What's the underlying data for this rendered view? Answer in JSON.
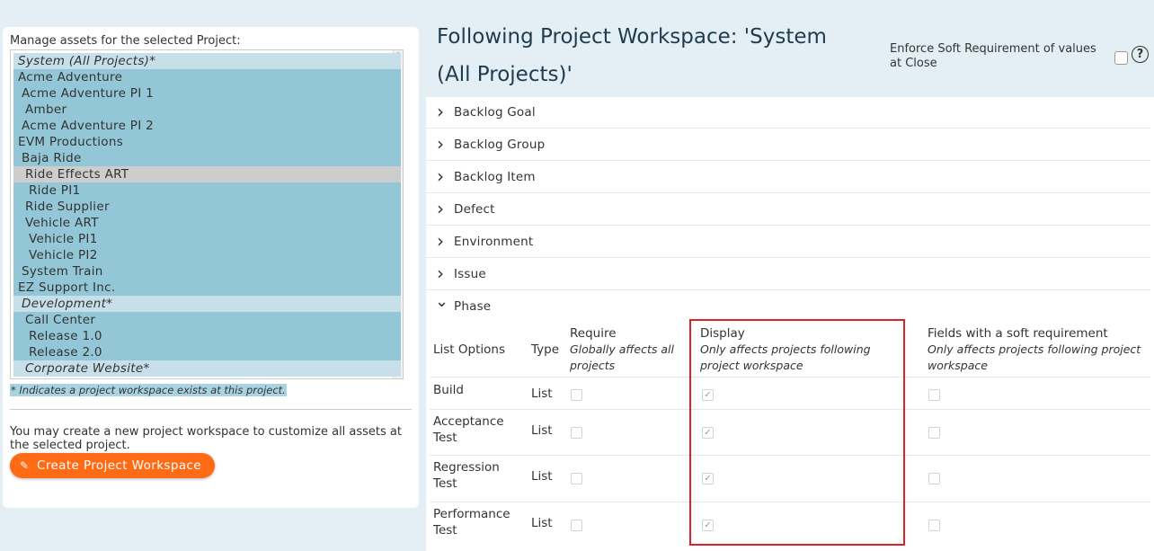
{
  "left_panel": {
    "manage_label": "Manage assets for the selected Project:",
    "projects": [
      {
        "label": "System (All Projects)*",
        "indent": 0,
        "workspace": true
      },
      {
        "label": "Acme Adventure",
        "indent": 0
      },
      {
        "label": "Acme Adventure PI 1",
        "indent": 1
      },
      {
        "label": "Amber",
        "indent": 2
      },
      {
        "label": "Acme Adventure PI 2",
        "indent": 1
      },
      {
        "label": "EVM Productions",
        "indent": 0
      },
      {
        "label": "Baja Ride",
        "indent": 1
      },
      {
        "label": "Ride Effects ART",
        "indent": 2,
        "selected": true
      },
      {
        "label": "Ride PI1",
        "indent": 3
      },
      {
        "label": "Ride Supplier",
        "indent": 2
      },
      {
        "label": "Vehicle ART",
        "indent": 2
      },
      {
        "label": "Vehicle PI1",
        "indent": 3
      },
      {
        "label": "Vehicle PI2",
        "indent": 3
      },
      {
        "label": "System Train",
        "indent": 1
      },
      {
        "label": "EZ Support Inc.",
        "indent": 0
      },
      {
        "label": "Development*",
        "indent": 1,
        "workspace": true
      },
      {
        "label": "Call Center",
        "indent": 2
      },
      {
        "label": "Release 1.0",
        "indent": 3
      },
      {
        "label": "Release 2.0",
        "indent": 3
      },
      {
        "label": "Corporate Website*",
        "indent": 2,
        "workspace": true
      }
    ],
    "legend_note": "* Indicates a project workspace exists at this project.",
    "create_note": "You may create a new project workspace to customize all assets at the selected project.",
    "create_button": "Create Project Workspace"
  },
  "header": {
    "title": "Following Project Workspace: 'System (All Projects)'",
    "enforce_label": "Enforce Soft Requirement of values at Close",
    "enforce_checked": false,
    "help": "?"
  },
  "assets": [
    {
      "name": "Backlog Goal",
      "expanded": false
    },
    {
      "name": "Backlog Group",
      "expanded": false
    },
    {
      "name": "Backlog Item",
      "expanded": false
    },
    {
      "name": "Defect",
      "expanded": false
    },
    {
      "name": "Environment",
      "expanded": false
    },
    {
      "name": "Issue",
      "expanded": false
    },
    {
      "name": "Phase",
      "expanded": true
    }
  ],
  "phase_table": {
    "headers": {
      "list_options": "List Options",
      "type": "Type",
      "require": "Require",
      "require_sub": "Globally affects all projects",
      "display": "Display",
      "display_sub": "Only affects projects following project workspace",
      "soft": "Fields with a soft requirement",
      "soft_sub": "Only affects projects following project workspace"
    },
    "rows": [
      {
        "name": "Build",
        "type": "List",
        "require": false,
        "display": true,
        "soft": false
      },
      {
        "name": "Acceptance Test",
        "type": "List",
        "require": false,
        "display": true,
        "soft": false
      },
      {
        "name": "Regression Test",
        "type": "List",
        "require": false,
        "display": true,
        "soft": false
      },
      {
        "name": "Performance Test",
        "type": "List",
        "require": false,
        "display": true,
        "soft": false
      }
    ]
  },
  "colors": {
    "accent": "#ff6a14",
    "highlight": "#d8232a",
    "list_selected_bg": "#93c6d6",
    "workspace_bg": "#c6dfe9"
  }
}
